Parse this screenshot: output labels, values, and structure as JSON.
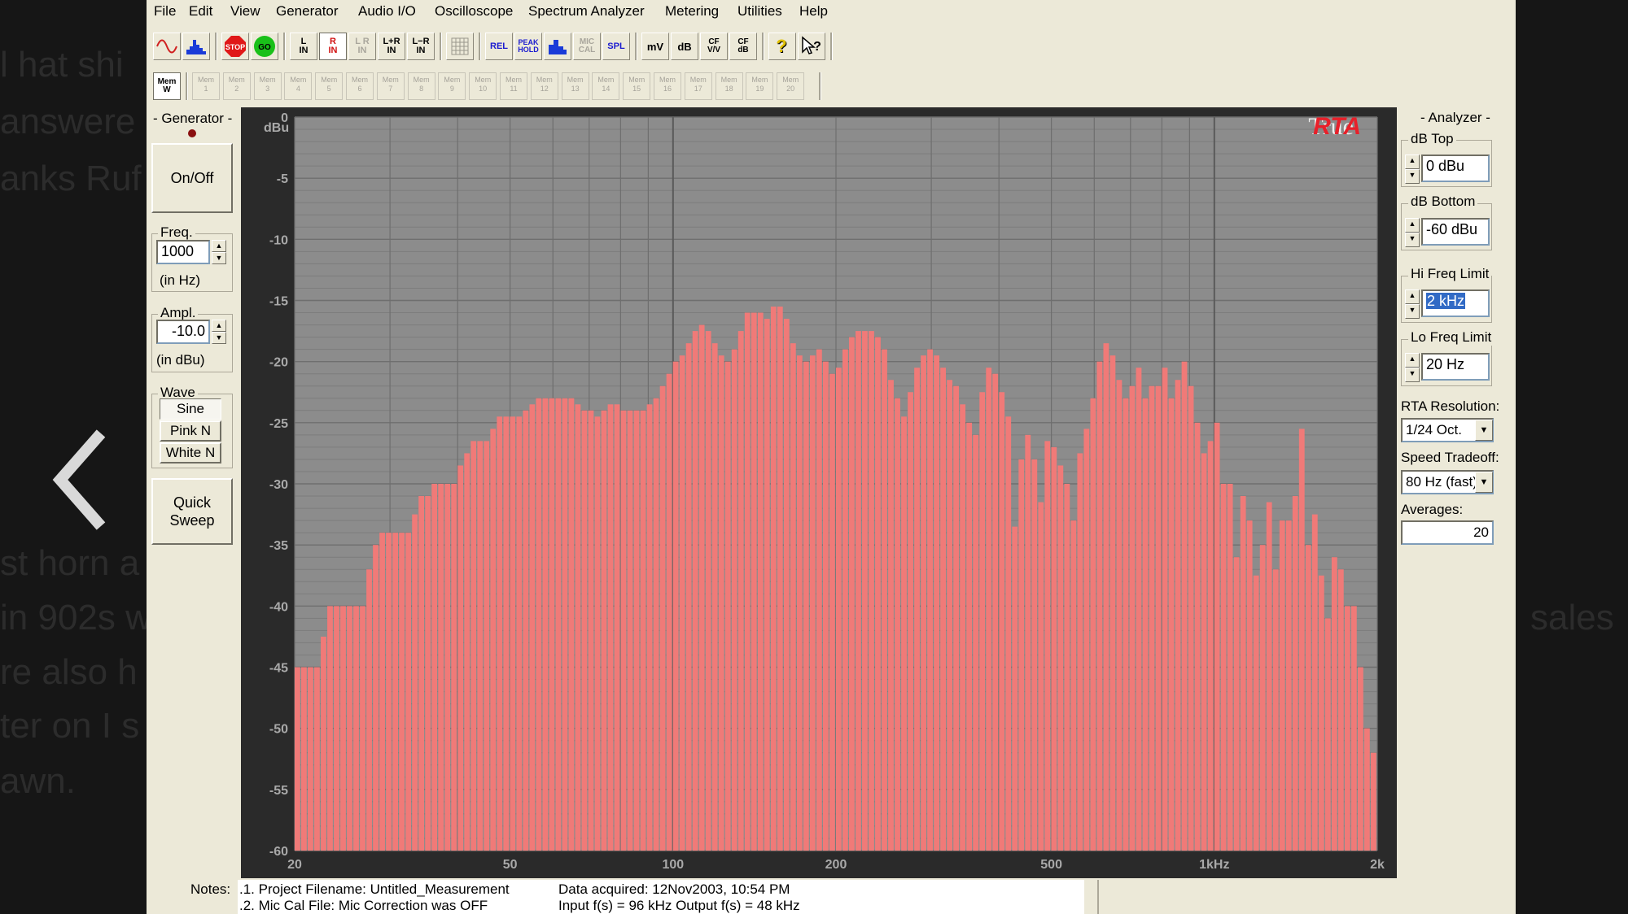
{
  "background_text": {
    "left_lines": [
      "l hat shi",
      "answere",
      "anks Ruf",
      "st horn a",
      "in 902s w",
      "re also h",
      "ter on I s",
      "awn."
    ],
    "right_fragment": "sales"
  },
  "menu": [
    "File",
    "Edit",
    "View",
    "Generator",
    "Audio I/O",
    "Oscilloscope",
    "Spectrum Analyzer",
    "Metering",
    "Utilities",
    "Help"
  ],
  "toolbar": {
    "stop_label": "STOP",
    "go_label": "GO",
    "l_in": "L\nIN",
    "r_in": "R\nIN",
    "lr_in": "L R\nIN",
    "lplusr_in": "L+R\nIN",
    "lminusr_in": "L−R\nIN",
    "rel": "REL",
    "peak_hold": "PEAK\nHOLD",
    "mic_cal": "MIC\nCAL",
    "spl": "SPL",
    "mv": "mV",
    "db": "dB",
    "cf_vv": "CF\nV/V",
    "cf_db": "CF\ndB"
  },
  "memory_bar": {
    "mem_w_label": "Mem\nW",
    "slots": [
      "Mem\n1",
      "Mem\n2",
      "Mem\n3",
      "Mem\n4",
      "Mem\n5",
      "Mem\n6",
      "Mem\n7",
      "Mem\n8",
      "Mem\n9",
      "Mem\n10",
      "Mem\n11",
      "Mem\n12",
      "Mem\n13",
      "Mem\n14",
      "Mem\n15",
      "Mem\n16",
      "Mem\n17",
      "Mem\n18",
      "Mem\n19",
      "Mem\n20"
    ]
  },
  "generator": {
    "title": "- Generator -",
    "on_off": "On/Off",
    "freq_label": "Freq.",
    "freq_value": "1000",
    "freq_unit": "(in Hz)",
    "ampl_label": "Ampl.",
    "ampl_value": "-10.0",
    "ampl_unit": "(in dBu)",
    "wave_label": "Wave",
    "waves": [
      "Sine",
      "Pink N",
      "White N"
    ],
    "quick_sweep": "Quick\nSweep"
  },
  "analyzer": {
    "title": "- Analyzer -",
    "db_top_label": "dB Top",
    "db_top_value": "0 dBu",
    "db_bottom_label": "dB Bottom",
    "db_bottom_value": "-60 dBu",
    "hi_freq_label": "Hi Freq Limit",
    "hi_freq_value": "2 kHz",
    "lo_freq_label": "Lo Freq Limit",
    "lo_freq_value": "20 Hz",
    "rta_res_label": "RTA Resolution:",
    "rta_res_value": "1/24 Oct.",
    "speed_label": "Speed Tradeoff:",
    "speed_value": "80 Hz (fast)",
    "averages_label": "Averages:",
    "averages_value": "20"
  },
  "notes": {
    "label": "Notes:",
    "line1": ".1. Project Filename: Untitled_Measurement",
    "line2": ".2. Mic Cal File: Mic Correction was OFF",
    "col2_line1": "Data acquired: 12Nov2003, 10:54 PM",
    "col2_line2": "Input f(s) = 96 kHz   Output f(s) = 48 kHz"
  },
  "colors": {
    "bars": "#f07a78",
    "plot_bg": "#8c8c8c",
    "logo_red": "#e8202a"
  },
  "chart_data": {
    "type": "bar",
    "logo": "TrueRTA",
    "ylabel": "dBu",
    "ylim": [
      -60,
      0
    ],
    "y_ticks": [
      0,
      -5,
      -10,
      -15,
      -20,
      -25,
      -30,
      -35,
      -40,
      -45,
      -50,
      -55,
      -60
    ],
    "x_scale": "log",
    "xlim": [
      20,
      2000
    ],
    "x_ticks": [
      {
        "value": 20,
        "label": "20"
      },
      {
        "value": 50,
        "label": "50"
      },
      {
        "value": 100,
        "label": "100"
      },
      {
        "value": 200,
        "label": "200"
      },
      {
        "value": 500,
        "label": "500"
      },
      {
        "value": 1000,
        "label": "1kHz"
      },
      {
        "value": 2000,
        "label": "2k"
      }
    ],
    "resolution": "1/24 octave",
    "values": [
      -45.0,
      -45.0,
      -45.0,
      -45.0,
      -42.5,
      -40.0,
      -40.0,
      -40.0,
      -40.0,
      -40.0,
      -40.0,
      -37.0,
      -35.0,
      -34.0,
      -34.0,
      -34.0,
      -34.0,
      -34.0,
      -32.5,
      -31.0,
      -31.0,
      -30.0,
      -30.0,
      -30.0,
      -30.0,
      -28.5,
      -27.5,
      -26.5,
      -26.5,
      -26.5,
      -25.5,
      -24.5,
      -24.5,
      -24.5,
      -24.5,
      -24.0,
      -23.5,
      -23.0,
      -23.0,
      -23.0,
      -23.0,
      -23.0,
      -23.0,
      -23.5,
      -24.0,
      -24.0,
      -24.5,
      -24.0,
      -23.5,
      -23.5,
      -24.0,
      -24.0,
      -24.0,
      -24.0,
      -23.5,
      -23.0,
      -22.0,
      -21.0,
      -20.0,
      -19.5,
      -18.5,
      -17.5,
      -17.0,
      -17.5,
      -18.5,
      -19.5,
      -20.0,
      -19.0,
      -17.5,
      -16.0,
      -16.0,
      -16.0,
      -16.5,
      -15.5,
      -15.5,
      -16.5,
      -18.5,
      -19.5,
      -20.0,
      -19.5,
      -19.0,
      -20.0,
      -21.0,
      -20.5,
      -19.0,
      -18.0,
      -17.5,
      -17.5,
      -17.5,
      -18.0,
      -19.0,
      -21.5,
      -23.0,
      -24.5,
      -22.5,
      -20.5,
      -19.5,
      -19.0,
      -19.5,
      -20.5,
      -21.5,
      -22.0,
      -23.5,
      -25.0,
      -26.0,
      -22.5,
      -20.5,
      -21.0,
      -22.5,
      -24.5,
      -33.5,
      -28.0,
      -26.0,
      -28.0,
      -31.5,
      -26.5,
      -27.0,
      -28.5,
      -30.0,
      -33.0,
      -27.5,
      -25.5,
      -23.0,
      -20.0,
      -18.5,
      -19.5,
      -21.5,
      -23.0,
      -22.0,
      -20.5,
      -23.0,
      -22.0,
      -22.0,
      -20.5,
      -23.0,
      -21.5,
      -20.0,
      -22.0,
      -25.0,
      -27.5,
      -26.5,
      -25.0,
      -30.0,
      -30.0,
      -36.0,
      -31.0,
      -33.0,
      -37.5,
      -35.0,
      -31.5,
      -37.0,
      -33.0,
      -33.0,
      -31.0,
      -25.5,
      -35.0,
      -32.5,
      -37.5,
      -41.0,
      -36.0,
      -37.0,
      -40.0,
      -40.0,
      -45.0,
      -50.0,
      -52.0
    ]
  }
}
